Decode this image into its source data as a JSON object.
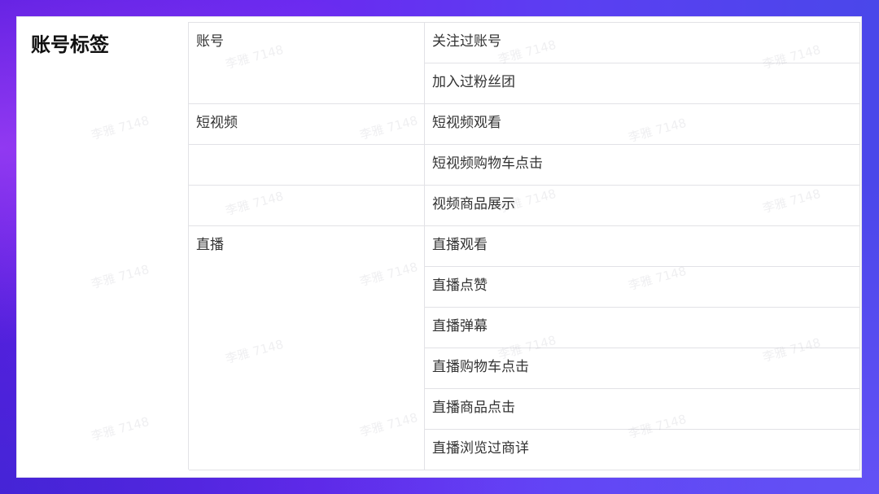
{
  "table": {
    "title": "账号标签",
    "groups": [
      {
        "name": "账号",
        "items": [
          "关注过账号",
          "加入过粉丝团"
        ]
      },
      {
        "name": "短视频",
        "items": [
          "短视频观看",
          "短视频购物车点击",
          "视频商品展示"
        ]
      },
      {
        "name": "直播",
        "items": [
          "直播观看",
          "直播点赞",
          "直播弹幕",
          "直播购物车点击",
          "直播商品点击",
          "直播浏览过商详"
        ]
      }
    ]
  },
  "watermark": "李雅 7148"
}
